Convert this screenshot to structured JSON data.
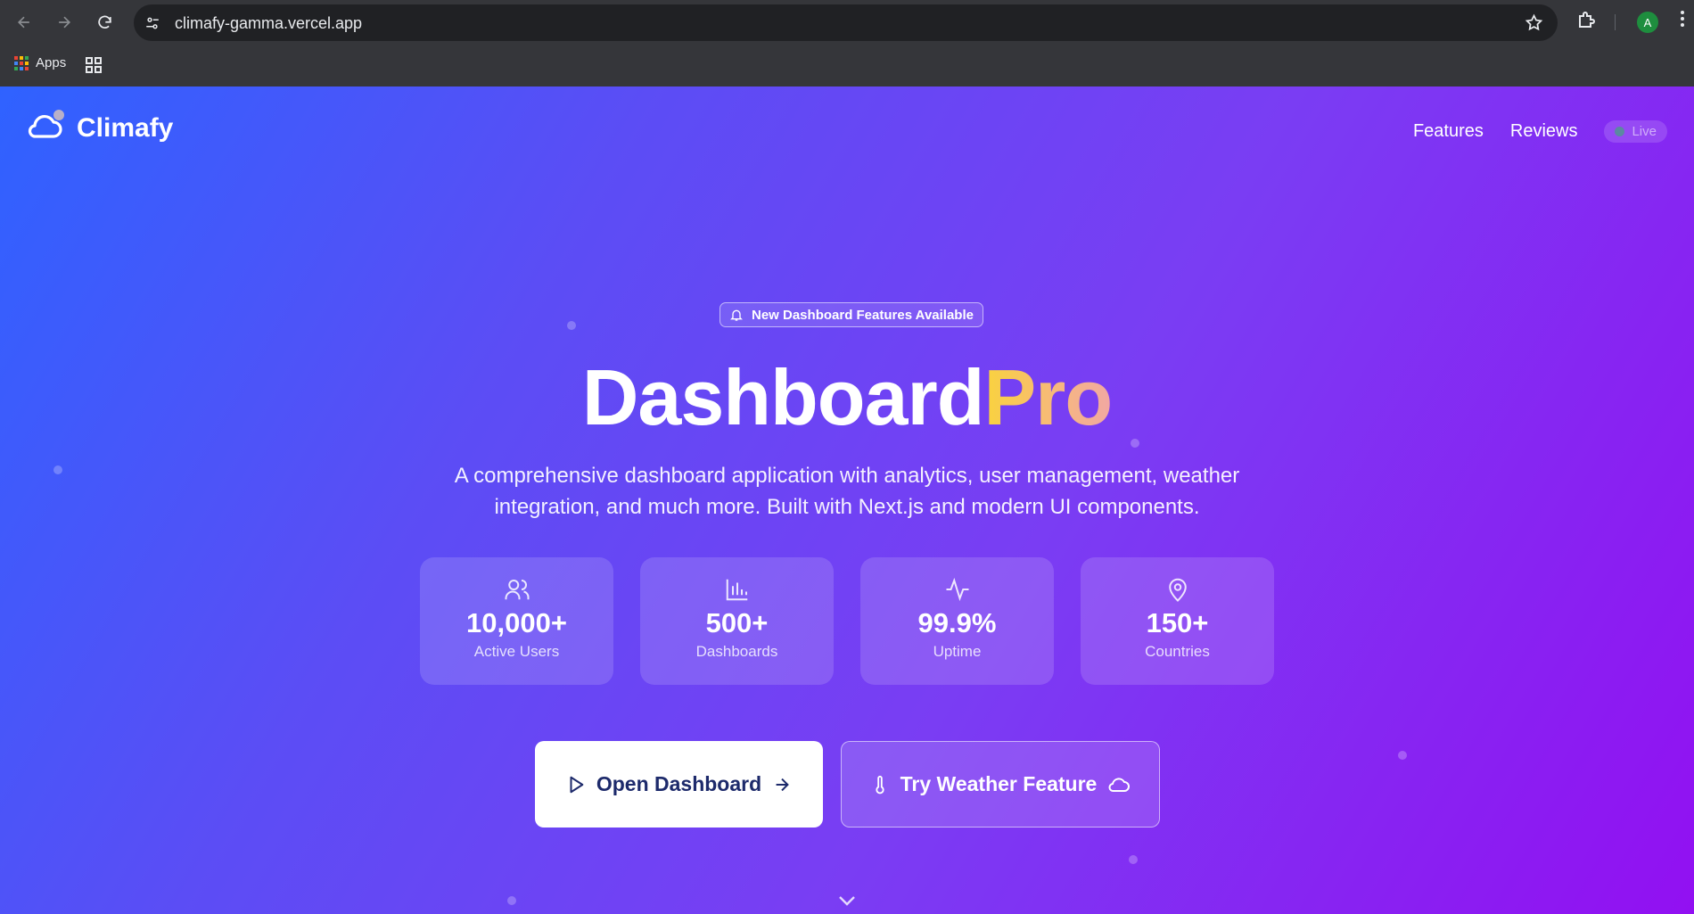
{
  "browser": {
    "url": "climafy-gamma.vercel.app",
    "bookmarks": {
      "apps_label": "Apps"
    },
    "profile_initial": "A"
  },
  "header": {
    "logo_text": "Climafy",
    "nav": [
      "Features",
      "Reviews"
    ],
    "live_label": "Live"
  },
  "hero": {
    "badge": "New Dashboard Features Available",
    "title_main": "Dashboard",
    "title_accent": "Pro",
    "subtitle": "A comprehensive dashboard application with analytics, user management, weather integration, and much more. Built with Next.js and modern UI components."
  },
  "stats": [
    {
      "icon": "users-icon",
      "value": "10,000+",
      "label": "Active Users"
    },
    {
      "icon": "bar-chart-icon",
      "value": "500+",
      "label": "Dashboards"
    },
    {
      "icon": "activity-icon",
      "value": "99.9%",
      "label": "Uptime"
    },
    {
      "icon": "map-pin-icon",
      "value": "150+",
      "label": "Countries"
    }
  ],
  "cta": {
    "primary": "Open Dashboard",
    "secondary": "Try Weather Feature"
  },
  "colors": {
    "gradient_start": "#2f62ff",
    "gradient_end": "#9210f2",
    "accent_gold": "#f9d33c",
    "live_green": "#35b36a"
  }
}
